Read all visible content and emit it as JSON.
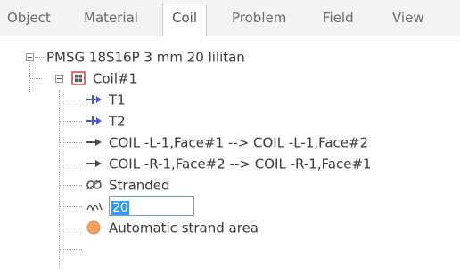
{
  "tabs": [
    "Object",
    "Material",
    "Coil",
    "Problem",
    "Field",
    "View"
  ],
  "active_tab": "Coil",
  "tree": {
    "root_label": "PMSG 18S16P 3 mm 20 lilitan",
    "coil_label": "Coil#1",
    "terminals": [
      "T1",
      "T2"
    ],
    "connections": [
      "COIL -L-1,Face#1 --> COIL -L-1,Face#2",
      "COIL -R-1,Face#2 --> COIL -R-1,Face#1"
    ],
    "stranded_label": "Stranded",
    "turns_value": "20",
    "strand_area_label": "Automatic strand area"
  },
  "icons": {
    "expander": "minus-box-icon",
    "coil": "coil-icon",
    "terminal": "terminal-plus-arrow-icon",
    "connection": "arrow-right-icon",
    "stranded": "stranded-icon",
    "turns": "turns-icon",
    "strand_area": "orange-circle-icon"
  },
  "colors": {
    "terminal_blue": "#4a5ad8",
    "coil_red": "#d24040",
    "strand_orange": "#f4a261",
    "selection_blue": "#3399ff"
  }
}
